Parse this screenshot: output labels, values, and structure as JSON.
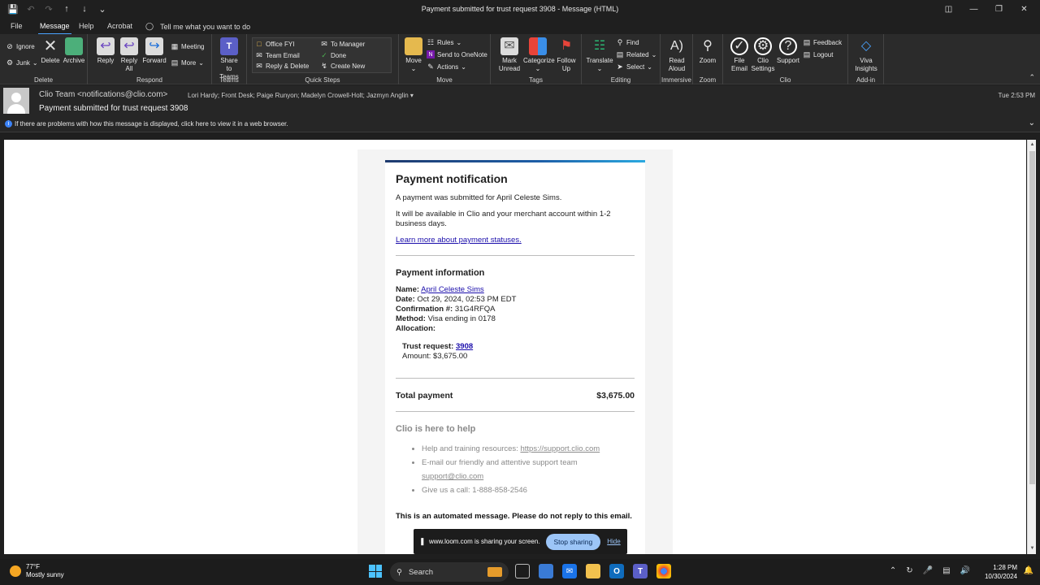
{
  "window": {
    "title": "Payment submitted for trust request 3908  -  Message (HTML)"
  },
  "menu": {
    "tabs": [
      "File",
      "Message",
      "Help",
      "Acrobat"
    ],
    "tell_me": "Tell me what you want to do"
  },
  "ribbon": {
    "delete_group": {
      "label": "Delete",
      "ignore": "Ignore",
      "junk": "Junk",
      "delete": "Delete",
      "archive": "Archive"
    },
    "respond_group": {
      "label": "Respond",
      "reply": "Reply",
      "reply_all_1": "Reply",
      "reply_all_2": "All",
      "forward": "Forward",
      "meeting": "Meeting",
      "more": "More"
    },
    "teams_group": {
      "label": "Teams",
      "share_1": "Share to",
      "share_2": "Teams"
    },
    "quick_steps_group": {
      "label": "Quick Steps",
      "items": [
        "Office FYI",
        "To Manager",
        "Team Email",
        "Done",
        "Reply & Delete",
        "Create New"
      ]
    },
    "move_group": {
      "label": "Move",
      "move": "Move",
      "rules": "Rules",
      "onenote": "Send to OneNote",
      "actions": "Actions"
    },
    "tags_group": {
      "label": "Tags",
      "mark_1": "Mark",
      "mark_2": "Unread",
      "categorize": "Categorize",
      "follow_1": "Follow",
      "follow_2": "Up"
    },
    "editing_group": {
      "label": "Editing",
      "translate": "Translate",
      "find": "Find",
      "related": "Related",
      "select": "Select"
    },
    "immersive_group": {
      "label": "Immersive",
      "read_1": "Read",
      "read_2": "Aloud"
    },
    "zoom_group": {
      "label": "Zoom",
      "zoom": "Zoom"
    },
    "clio_group": {
      "label": "Clio",
      "file_1": "File",
      "file_2": "Email",
      "settings_1": "Clio",
      "settings_2": "Settings",
      "support": "Support",
      "feedback": "Feedback",
      "logout": "Logout"
    },
    "addin_group": {
      "label": "Add-in",
      "viva_1": "Viva",
      "viva_2": "Insights"
    }
  },
  "message": {
    "from": "Clio Team <notifications@clio.com>",
    "to": "Lori Hardy; Front Desk; Paige Runyon; Madelyn Crowell-Holt; Jazmyn Anglin",
    "subject": "Payment submitted for trust request 3908",
    "time": "Tue 2:53 PM",
    "info": "If there are problems with how this message is displayed, click here to view it in a web browser."
  },
  "email": {
    "title": "Payment notification",
    "line1": "A payment was submitted for April Celeste Sims.",
    "line2": "It will be available in Clio and your merchant account within 1-2 business days.",
    "learn_link": "Learn more about payment statuses.",
    "info_title": "Payment information",
    "name_label": "Name:",
    "name_value": "April Celeste Sims",
    "date_label": "Date:",
    "date_value": "Oct 29, 2024, 02:53 PM EDT",
    "conf_label": "Confirmation #:",
    "conf_value": "31G4RFQA",
    "method_label": "Method:",
    "method_value": "Visa ending in 0178",
    "alloc_label": "Allocation:",
    "trust_label": "Trust request:",
    "trust_value": "3908",
    "amount_label": "Amount:",
    "amount_value": "$3,675.00",
    "total_label": "Total payment",
    "total_value": "$3,675.00",
    "help_title": "Clio is here to help",
    "help_1_text": "Help and training resources:",
    "help_1_link": "https://support.clio.com",
    "help_2_text": "E-mail our friendly and attentive support team",
    "help_2_link": "support@clio.com",
    "help_3": "Give us a call: 1-888-858-2546",
    "automated": "This is an automated message. Please do not reply to this email."
  },
  "loom": {
    "message": "www.loom.com is sharing your screen.",
    "stop": "Stop sharing",
    "hide": "Hide"
  },
  "taskbar": {
    "temp": "77°F",
    "weather": "Mostly sunny",
    "search": "Search",
    "time": "1:28 PM",
    "date": "10/30/2024"
  }
}
